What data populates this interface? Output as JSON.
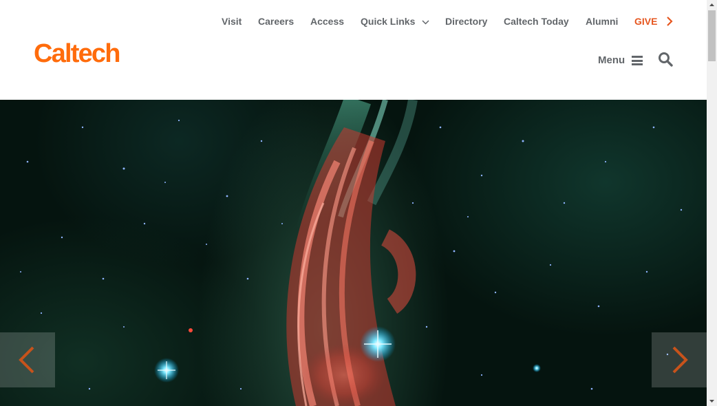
{
  "logo": {
    "text": "Caltech"
  },
  "utility_nav": {
    "items": [
      {
        "label": "Visit"
      },
      {
        "label": "Careers"
      },
      {
        "label": "Access"
      },
      {
        "label": "Quick Links"
      },
      {
        "label": "Directory"
      },
      {
        "label": "Caltech Today"
      },
      {
        "label": "Alumni"
      },
      {
        "label": "GIVE"
      }
    ]
  },
  "menu": {
    "label": "Menu"
  },
  "icons": {
    "quick_links": "chevron-down-icon",
    "give": "chevron-right-icon",
    "menu": "hamburger-icon",
    "search": "search-icon",
    "prev": "chevron-left-icon",
    "next": "chevron-right-icon"
  },
  "colors": {
    "brand": "#ff6c0c",
    "give": "#e6561f",
    "nav_text": "#62666a",
    "slider_arrow": "#c7531b"
  }
}
